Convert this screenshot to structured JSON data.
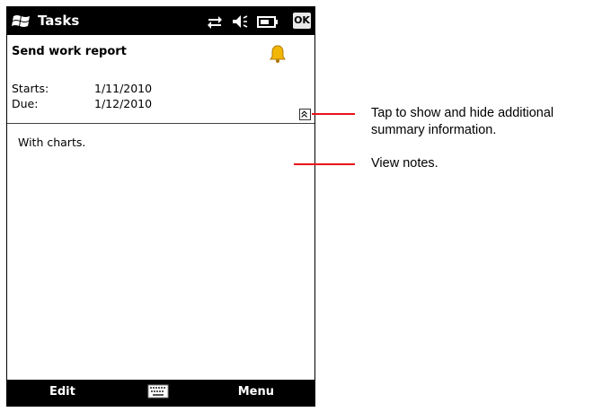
{
  "titlebar": {
    "title": "Tasks",
    "ok_label": "OK",
    "icons": [
      "windows-start-icon",
      "connectivity-icon",
      "volume-icon",
      "battery-icon"
    ]
  },
  "task": {
    "title": "Send work report",
    "reminder_icon": "bell-icon",
    "starts_label": "Starts:",
    "starts_value": "1/11/2010",
    "due_label": "Due:",
    "due_value": "1/12/2010",
    "notes": "With charts."
  },
  "softkeys": {
    "left": "Edit",
    "center_icon": "keyboard-icon",
    "right": "Menu"
  },
  "callouts": [
    {
      "text_line1": "Tap to show and hide additional",
      "text_line2": "summary information."
    },
    {
      "text_line1": "View notes."
    }
  ],
  "colors": {
    "bar": "#000000",
    "callout": "#e8121a",
    "bell": "#f2b705"
  }
}
